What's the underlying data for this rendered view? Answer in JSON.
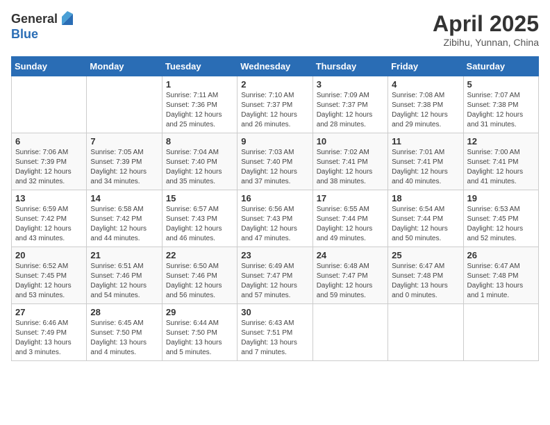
{
  "header": {
    "logo_general": "General",
    "logo_blue": "Blue",
    "month_title": "April 2025",
    "location": "Zibihu, Yunnan, China"
  },
  "days_of_week": [
    "Sunday",
    "Monday",
    "Tuesday",
    "Wednesday",
    "Thursday",
    "Friday",
    "Saturday"
  ],
  "weeks": [
    [
      {
        "day": "",
        "sunrise": "",
        "sunset": "",
        "daylight": ""
      },
      {
        "day": "",
        "sunrise": "",
        "sunset": "",
        "daylight": ""
      },
      {
        "day": "1",
        "sunrise": "Sunrise: 7:11 AM",
        "sunset": "Sunset: 7:36 PM",
        "daylight": "Daylight: 12 hours and 25 minutes."
      },
      {
        "day": "2",
        "sunrise": "Sunrise: 7:10 AM",
        "sunset": "Sunset: 7:37 PM",
        "daylight": "Daylight: 12 hours and 26 minutes."
      },
      {
        "day": "3",
        "sunrise": "Sunrise: 7:09 AM",
        "sunset": "Sunset: 7:37 PM",
        "daylight": "Daylight: 12 hours and 28 minutes."
      },
      {
        "day": "4",
        "sunrise": "Sunrise: 7:08 AM",
        "sunset": "Sunset: 7:38 PM",
        "daylight": "Daylight: 12 hours and 29 minutes."
      },
      {
        "day": "5",
        "sunrise": "Sunrise: 7:07 AM",
        "sunset": "Sunset: 7:38 PM",
        "daylight": "Daylight: 12 hours and 31 minutes."
      }
    ],
    [
      {
        "day": "6",
        "sunrise": "Sunrise: 7:06 AM",
        "sunset": "Sunset: 7:39 PM",
        "daylight": "Daylight: 12 hours and 32 minutes."
      },
      {
        "day": "7",
        "sunrise": "Sunrise: 7:05 AM",
        "sunset": "Sunset: 7:39 PM",
        "daylight": "Daylight: 12 hours and 34 minutes."
      },
      {
        "day": "8",
        "sunrise": "Sunrise: 7:04 AM",
        "sunset": "Sunset: 7:40 PM",
        "daylight": "Daylight: 12 hours and 35 minutes."
      },
      {
        "day": "9",
        "sunrise": "Sunrise: 7:03 AM",
        "sunset": "Sunset: 7:40 PM",
        "daylight": "Daylight: 12 hours and 37 minutes."
      },
      {
        "day": "10",
        "sunrise": "Sunrise: 7:02 AM",
        "sunset": "Sunset: 7:41 PM",
        "daylight": "Daylight: 12 hours and 38 minutes."
      },
      {
        "day": "11",
        "sunrise": "Sunrise: 7:01 AM",
        "sunset": "Sunset: 7:41 PM",
        "daylight": "Daylight: 12 hours and 40 minutes."
      },
      {
        "day": "12",
        "sunrise": "Sunrise: 7:00 AM",
        "sunset": "Sunset: 7:41 PM",
        "daylight": "Daylight: 12 hours and 41 minutes."
      }
    ],
    [
      {
        "day": "13",
        "sunrise": "Sunrise: 6:59 AM",
        "sunset": "Sunset: 7:42 PM",
        "daylight": "Daylight: 12 hours and 43 minutes."
      },
      {
        "day": "14",
        "sunrise": "Sunrise: 6:58 AM",
        "sunset": "Sunset: 7:42 PM",
        "daylight": "Daylight: 12 hours and 44 minutes."
      },
      {
        "day": "15",
        "sunrise": "Sunrise: 6:57 AM",
        "sunset": "Sunset: 7:43 PM",
        "daylight": "Daylight: 12 hours and 46 minutes."
      },
      {
        "day": "16",
        "sunrise": "Sunrise: 6:56 AM",
        "sunset": "Sunset: 7:43 PM",
        "daylight": "Daylight: 12 hours and 47 minutes."
      },
      {
        "day": "17",
        "sunrise": "Sunrise: 6:55 AM",
        "sunset": "Sunset: 7:44 PM",
        "daylight": "Daylight: 12 hours and 49 minutes."
      },
      {
        "day": "18",
        "sunrise": "Sunrise: 6:54 AM",
        "sunset": "Sunset: 7:44 PM",
        "daylight": "Daylight: 12 hours and 50 minutes."
      },
      {
        "day": "19",
        "sunrise": "Sunrise: 6:53 AM",
        "sunset": "Sunset: 7:45 PM",
        "daylight": "Daylight: 12 hours and 52 minutes."
      }
    ],
    [
      {
        "day": "20",
        "sunrise": "Sunrise: 6:52 AM",
        "sunset": "Sunset: 7:45 PM",
        "daylight": "Daylight: 12 hours and 53 minutes."
      },
      {
        "day": "21",
        "sunrise": "Sunrise: 6:51 AM",
        "sunset": "Sunset: 7:46 PM",
        "daylight": "Daylight: 12 hours and 54 minutes."
      },
      {
        "day": "22",
        "sunrise": "Sunrise: 6:50 AM",
        "sunset": "Sunset: 7:46 PM",
        "daylight": "Daylight: 12 hours and 56 minutes."
      },
      {
        "day": "23",
        "sunrise": "Sunrise: 6:49 AM",
        "sunset": "Sunset: 7:47 PM",
        "daylight": "Daylight: 12 hours and 57 minutes."
      },
      {
        "day": "24",
        "sunrise": "Sunrise: 6:48 AM",
        "sunset": "Sunset: 7:47 PM",
        "daylight": "Daylight: 12 hours and 59 minutes."
      },
      {
        "day": "25",
        "sunrise": "Sunrise: 6:47 AM",
        "sunset": "Sunset: 7:48 PM",
        "daylight": "Daylight: 13 hours and 0 minutes."
      },
      {
        "day": "26",
        "sunrise": "Sunrise: 6:47 AM",
        "sunset": "Sunset: 7:48 PM",
        "daylight": "Daylight: 13 hours and 1 minute."
      }
    ],
    [
      {
        "day": "27",
        "sunrise": "Sunrise: 6:46 AM",
        "sunset": "Sunset: 7:49 PM",
        "daylight": "Daylight: 13 hours and 3 minutes."
      },
      {
        "day": "28",
        "sunrise": "Sunrise: 6:45 AM",
        "sunset": "Sunset: 7:50 PM",
        "daylight": "Daylight: 13 hours and 4 minutes."
      },
      {
        "day": "29",
        "sunrise": "Sunrise: 6:44 AM",
        "sunset": "Sunset: 7:50 PM",
        "daylight": "Daylight: 13 hours and 5 minutes."
      },
      {
        "day": "30",
        "sunrise": "Sunrise: 6:43 AM",
        "sunset": "Sunset: 7:51 PM",
        "daylight": "Daylight: 13 hours and 7 minutes."
      },
      {
        "day": "",
        "sunrise": "",
        "sunset": "",
        "daylight": ""
      },
      {
        "day": "",
        "sunrise": "",
        "sunset": "",
        "daylight": ""
      },
      {
        "day": "",
        "sunrise": "",
        "sunset": "",
        "daylight": ""
      }
    ]
  ]
}
